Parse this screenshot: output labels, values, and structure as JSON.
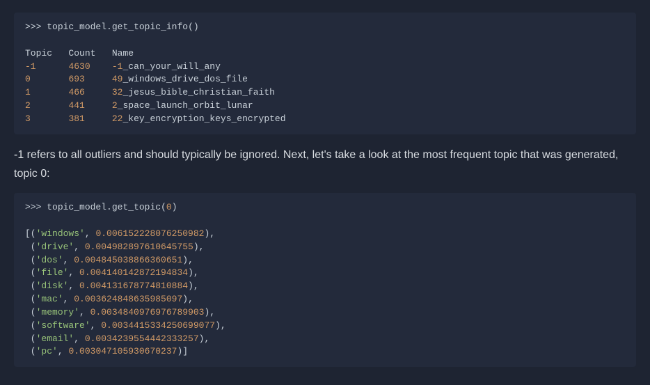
{
  "block1": {
    "prompt": ">>> ",
    "call_obj": "topic_model",
    "call_dot": ".",
    "call_method": "get_topic_info",
    "call_args": "()",
    "header_topic": "Topic",
    "header_count": "Count",
    "header_name": "Name",
    "rows": [
      {
        "topic": "-1",
        "count": "4630",
        "prefix": "-1",
        "rest": "_can_your_will_any"
      },
      {
        "topic": "0",
        "count": "693",
        "prefix": "49",
        "rest": "_windows_drive_dos_file"
      },
      {
        "topic": "1",
        "count": "466",
        "prefix": "32",
        "rest": "_jesus_bible_christian_faith"
      },
      {
        "topic": "2",
        "count": "441",
        "prefix": "2",
        "rest": "_space_launch_orbit_lunar"
      },
      {
        "topic": "3",
        "count": "381",
        "prefix": "22",
        "rest": "_key_encryption_keys_encrypted"
      }
    ]
  },
  "prose1": "-1 refers to all outliers and should typically be ignored. Next, let's take a look at the most frequent topic that was generated, topic 0:",
  "block2": {
    "prompt": ">>> ",
    "call_obj": "topic_model",
    "call_dot": ".",
    "call_method": "get_topic",
    "call_open": "(",
    "call_arg": "0",
    "call_close": ")",
    "open": "[(",
    "rows": [
      {
        "word": "'windows'",
        "sep": ", ",
        "val": "0.006152228076250982",
        "end": "),"
      },
      {
        "word": "'drive'",
        "sep": ", ",
        "val": "0.004982897610645755",
        "end": "),"
      },
      {
        "word": "'dos'",
        "sep": ", ",
        "val": "0.004845038866360651",
        "end": "),"
      },
      {
        "word": "'file'",
        "sep": ", ",
        "val": "0.004140142872194834",
        "end": "),"
      },
      {
        "word": "'disk'",
        "sep": ", ",
        "val": "0.004131678774810884",
        "end": "),"
      },
      {
        "word": "'mac'",
        "sep": ", ",
        "val": "0.003624848635985097",
        "end": "),"
      },
      {
        "word": "'memory'",
        "sep": ", ",
        "val": "0.0034840976976789903",
        "end": "),"
      },
      {
        "word": "'software'",
        "sep": ", ",
        "val": "0.0034415334250699077",
        "end": "),"
      },
      {
        "word": "'email'",
        "sep": ", ",
        "val": "0.0034239554442333257",
        "end": "),"
      },
      {
        "word": "'pc'",
        "sep": ", ",
        "val": "0.003047105930670237",
        "end": ")]"
      }
    ]
  }
}
